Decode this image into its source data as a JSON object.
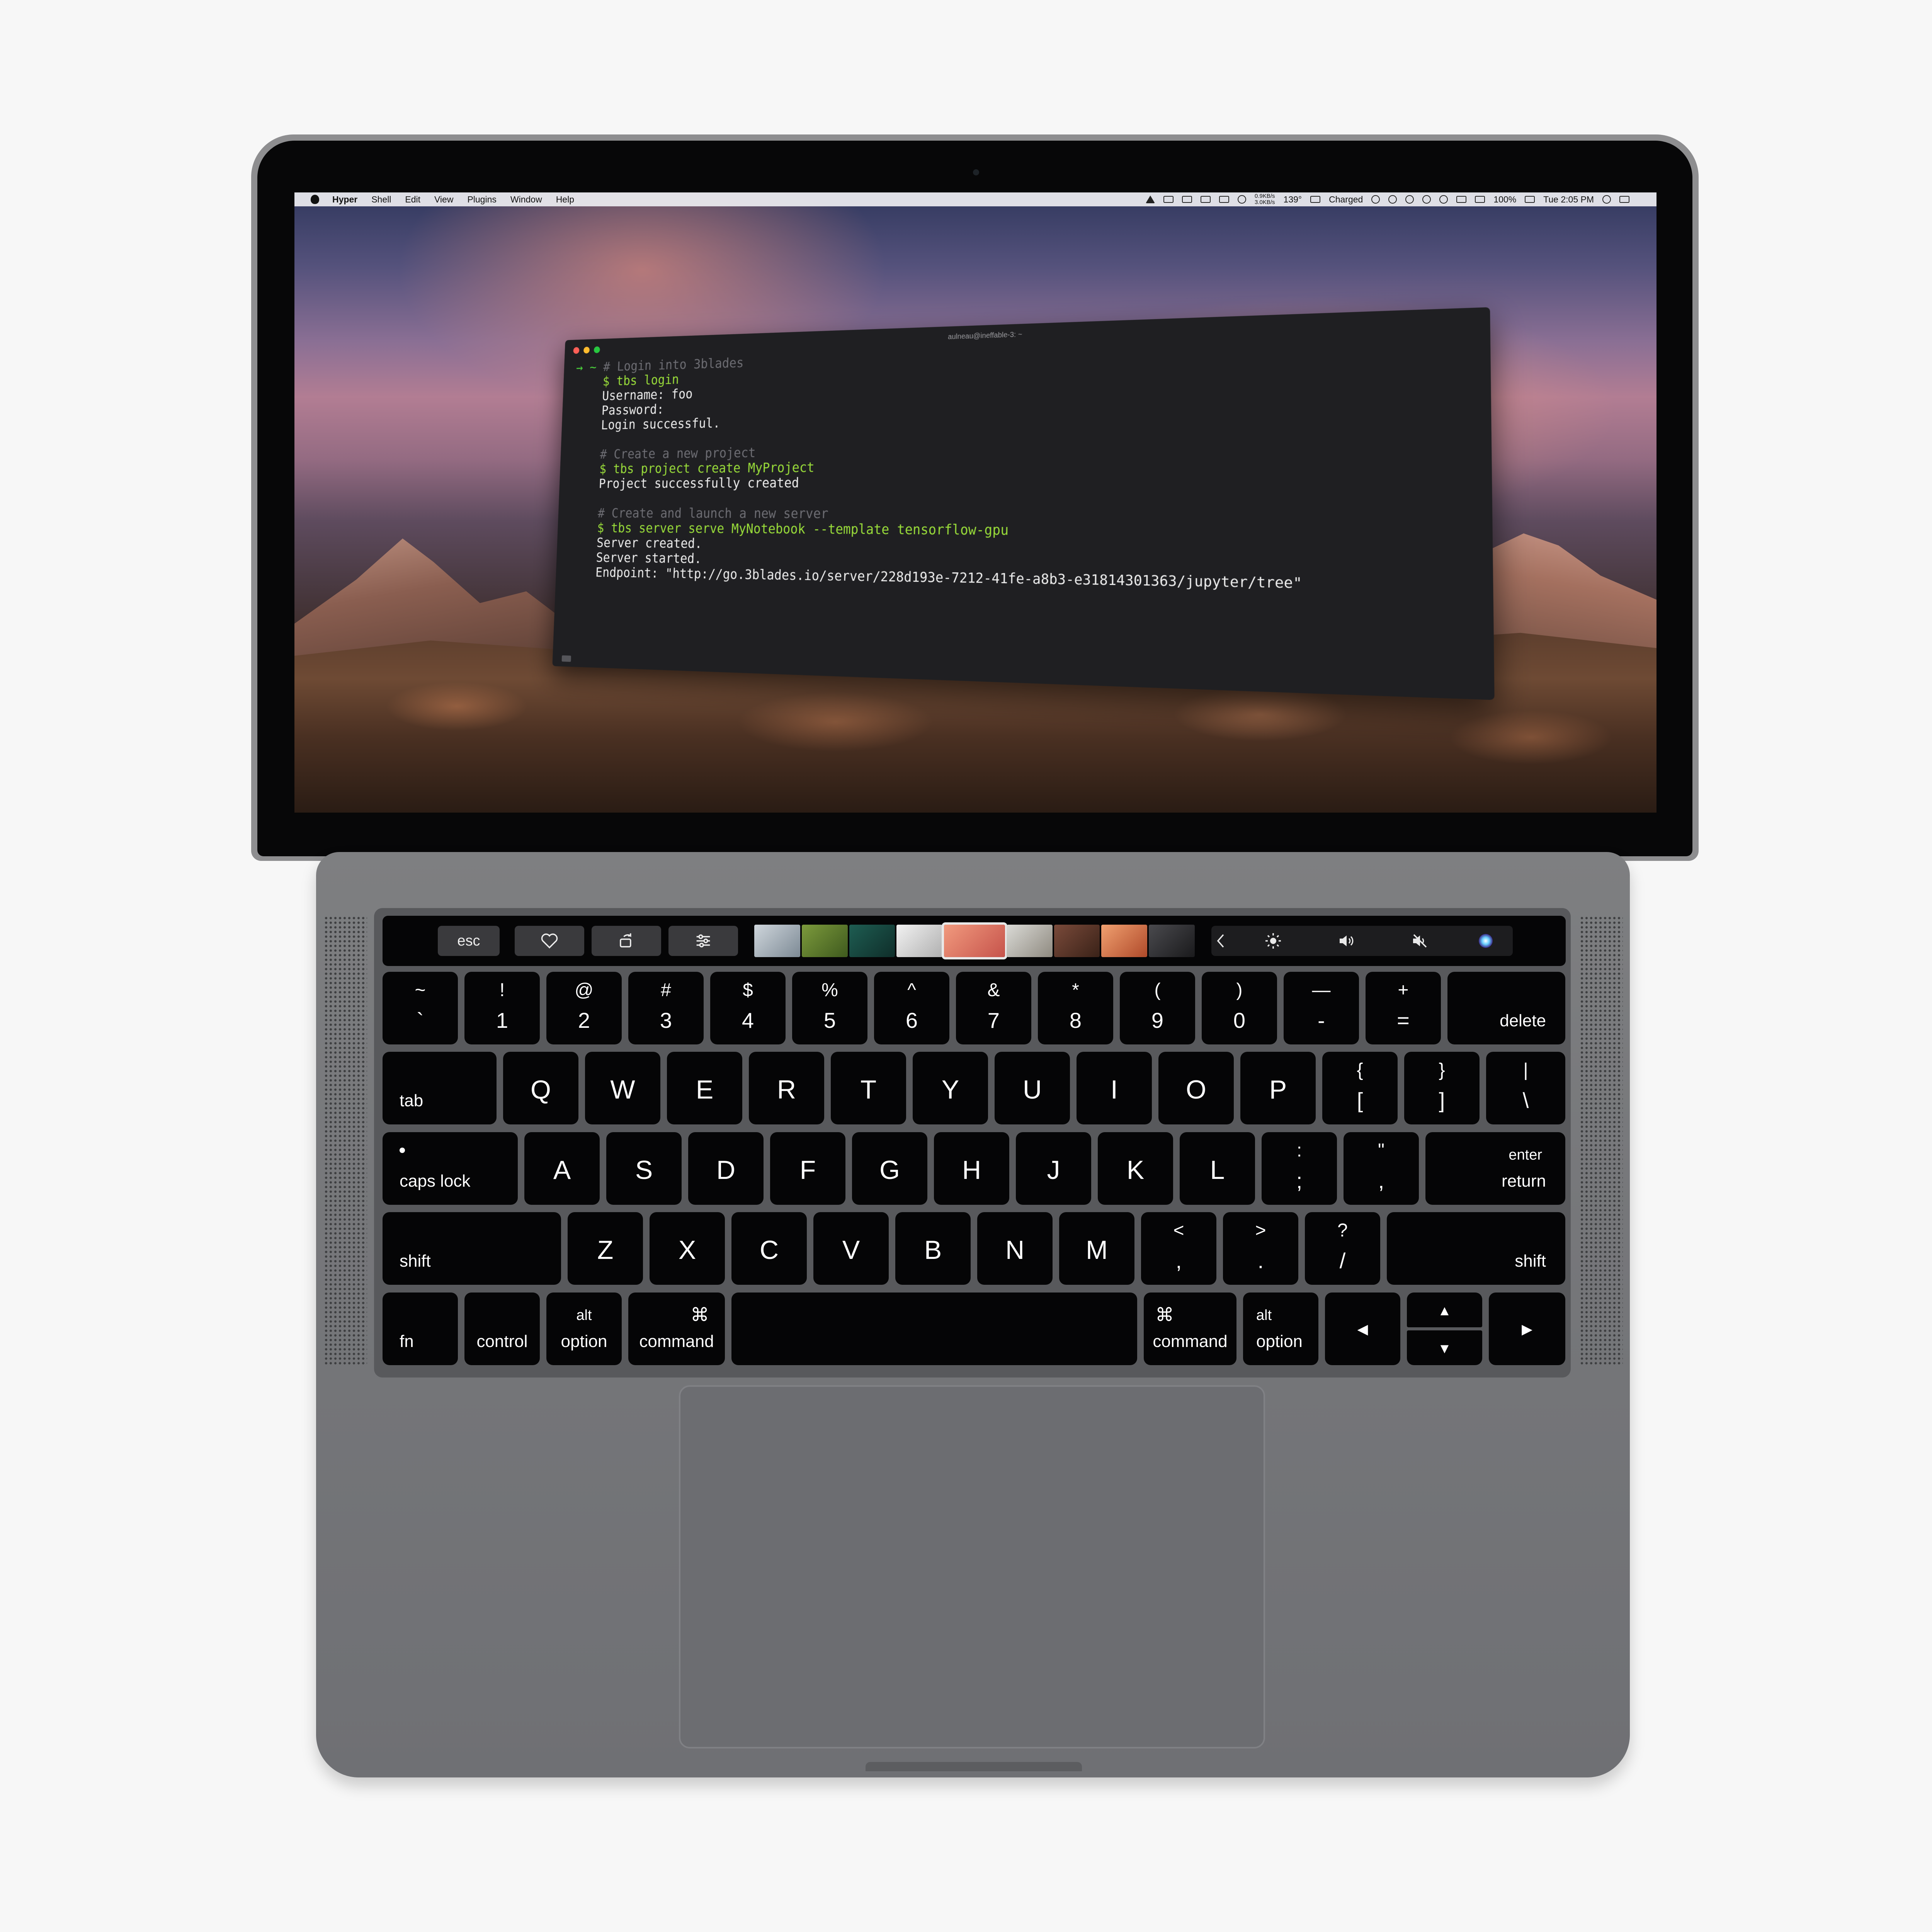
{
  "menubar": {
    "app": "Hyper",
    "items": [
      "Shell",
      "Edit",
      "View",
      "Plugins",
      "Window",
      "Help"
    ],
    "netstat": "0.9KB/s\n3.0KB/s",
    "temp": "139°",
    "power": "Charged",
    "battery": "100%",
    "clock": "Tue 2:05 PM"
  },
  "terminal": {
    "title": "aulneau@ineffable-3: ~",
    "prompt_mark": "→ ~",
    "lines": {
      "c1": "# Login into 3blades",
      "cmd1": "$ tbs login",
      "o1a": "Username: foo",
      "o1b": "Password:",
      "o1c": "Login successful.",
      "c2": "# Create a new project",
      "cmd2": "$ tbs project create MyProject",
      "o2a": "Project successfully created",
      "c3": "# Create and launch a new server",
      "cmd3": "$ tbs server serve MyNotebook --template tensorflow-gpu",
      "o3a": "Server created.",
      "o3b": "Server started.",
      "o3c": "Endpoint: \"http://go.3blades.io/server/228d193e-7212-41fe-a8b3-e31814301363/jupyter/tree\""
    }
  },
  "touchbar": {
    "esc": "esc",
    "icons": [
      "heart-icon",
      "rotate-icon",
      "sliders-icon",
      "chevron-left-icon",
      "brightness-icon",
      "volume-icon",
      "mute-icon",
      "siri-icon"
    ]
  },
  "keyboard": {
    "row1": [
      [
        "~",
        "`"
      ],
      [
        "!",
        "1"
      ],
      [
        "@",
        "2"
      ],
      [
        "#",
        "3"
      ],
      [
        "$",
        "4"
      ],
      [
        "%",
        "5"
      ],
      [
        "^",
        "6"
      ],
      [
        "&",
        "7"
      ],
      [
        "*",
        "8"
      ],
      [
        "(",
        "9"
      ],
      [
        ")",
        "0"
      ],
      [
        "—",
        "-"
      ],
      [
        "+",
        "="
      ]
    ],
    "delete": "delete",
    "tab": "tab",
    "row2": [
      "Q",
      "W",
      "E",
      "R",
      "T",
      "Y",
      "U",
      "I",
      "O",
      "P"
    ],
    "row2_brackets": [
      [
        "{",
        "["
      ],
      [
        "}",
        "]"
      ],
      [
        "|",
        "\\"
      ]
    ],
    "caps": "caps lock",
    "row3": [
      "A",
      "S",
      "D",
      "F",
      "G",
      "H",
      "J",
      "K",
      "L"
    ],
    "row3_punct": [
      [
        ":",
        ";"
      ],
      [
        "\"",
        ","
      ]
    ],
    "enter": "enter",
    "return": "return",
    "shift": "shift",
    "row4": [
      "Z",
      "X",
      "C",
      "V",
      "B",
      "N",
      "M"
    ],
    "row4_punct": [
      [
        "<",
        ","
      ],
      [
        ">",
        "."
      ],
      [
        "?",
        "/"
      ]
    ],
    "fn": "fn",
    "control": "control",
    "alt": "alt",
    "option": "option",
    "cmd_symbol": "⌘",
    "command": "command",
    "arrows": {
      "left": "◀",
      "up": "▲",
      "down": "▼",
      "right": "▶"
    }
  }
}
